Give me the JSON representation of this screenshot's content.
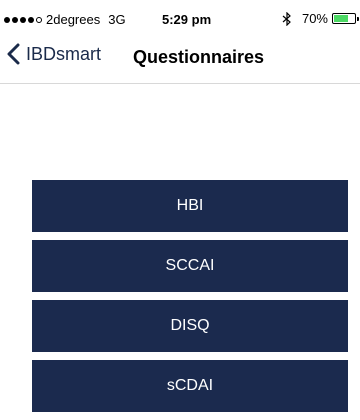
{
  "status_bar": {
    "carrier": "2degrees",
    "network": "3G",
    "time": "5:29 pm",
    "battery_percent": "70%",
    "battery_level": 0.7,
    "signal_bars_filled": 4,
    "signal_bars_total": 5
  },
  "nav": {
    "back_label": "IBDsmart",
    "title": "Questionnaires"
  },
  "questionnaires": [
    {
      "label": "HBI"
    },
    {
      "label": "SCCAI"
    },
    {
      "label": "DISQ"
    },
    {
      "label": "sCDAI"
    }
  ],
  "colors": {
    "button_bg": "#1b2a4e",
    "button_text": "#ffffff",
    "battery_fill": "#4cd964",
    "back_tint": "#1a2a4a"
  }
}
